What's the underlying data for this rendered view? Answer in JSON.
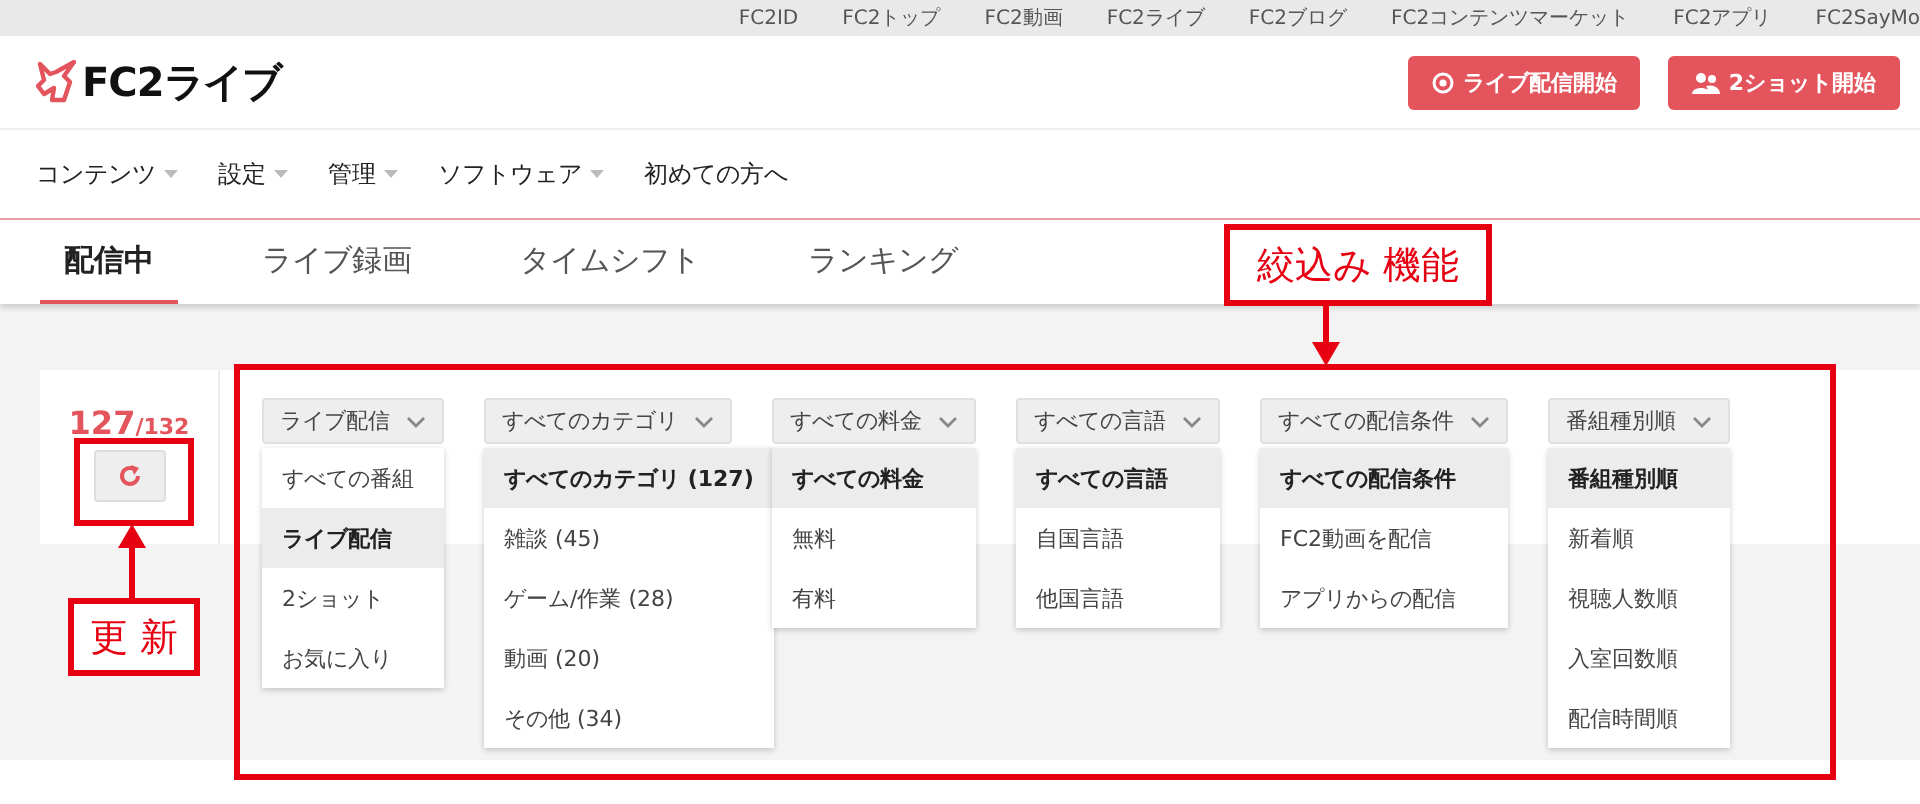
{
  "top_links": [
    "FC2ID",
    "FC2トップ",
    "FC2動画",
    "FC2ライブ",
    "FC2ブログ",
    "FC2コンテンツマーケット",
    "FC2アプリ",
    "FC2SayMo"
  ],
  "logo": {
    "text": "FC2ライブ"
  },
  "header_buttons": [
    {
      "label": "ライブ配信開始",
      "kind": "broadcast"
    },
    {
      "label": "2ショット開始",
      "kind": "people"
    }
  ],
  "nav": [
    {
      "label": "コンテンツ",
      "kind": "menu"
    },
    {
      "label": "設定",
      "kind": "menu"
    },
    {
      "label": "管理",
      "kind": "menu"
    },
    {
      "label": "ソフトウェア",
      "kind": "menu"
    },
    {
      "label": "初めての方へ",
      "kind": "link"
    }
  ],
  "tabs": [
    {
      "label": "配信中",
      "selected": true
    },
    {
      "label": "ライブ録画",
      "selected": false
    },
    {
      "label": "タイムシフト",
      "selected": false
    },
    {
      "label": "ランキング",
      "selected": false
    }
  ],
  "counter": {
    "count": "127",
    "total": "/132"
  },
  "filters": [
    {
      "label": "ライブ配信",
      "options": [
        {
          "label": "すべての番組",
          "selected": false
        },
        {
          "label": "ライブ配信",
          "selected": true
        },
        {
          "label": "2ショット",
          "selected": false
        },
        {
          "label": "お気に入り",
          "selected": false
        }
      ]
    },
    {
      "label": "すべてのカテゴリ",
      "options": [
        {
          "label": "すべてのカテゴリ (127)",
          "selected": true
        },
        {
          "label": "雑談 (45)",
          "selected": false
        },
        {
          "label": "ゲーム/作業 (28)",
          "selected": false
        },
        {
          "label": "動画 (20)",
          "selected": false
        },
        {
          "label": "その他 (34)",
          "selected": false
        }
      ]
    },
    {
      "label": "すべての料金",
      "options": [
        {
          "label": "すべての料金",
          "selected": true
        },
        {
          "label": "無料",
          "selected": false
        },
        {
          "label": "有料",
          "selected": false
        }
      ]
    },
    {
      "label": "すべての言語",
      "options": [
        {
          "label": "すべての言語",
          "selected": true
        },
        {
          "label": "自国言語",
          "selected": false
        },
        {
          "label": "他国言語",
          "selected": false
        }
      ]
    },
    {
      "label": "すべての配信条件",
      "options": [
        {
          "label": "すべての配信条件",
          "selected": true
        },
        {
          "label": "FC2動画を配信",
          "selected": false
        },
        {
          "label": "アプリからの配信",
          "selected": false
        }
      ]
    },
    {
      "label": "番組種別順",
      "options": [
        {
          "label": "番組種別順",
          "selected": true
        },
        {
          "label": "新着順",
          "selected": false
        },
        {
          "label": "視聴人数順",
          "selected": false
        },
        {
          "label": "入室回数順",
          "selected": false
        },
        {
          "label": "配信時間順",
          "selected": false
        }
      ]
    }
  ],
  "annotations": {
    "filter_label": "絞込み 機能",
    "refresh_label": "更 新"
  }
}
